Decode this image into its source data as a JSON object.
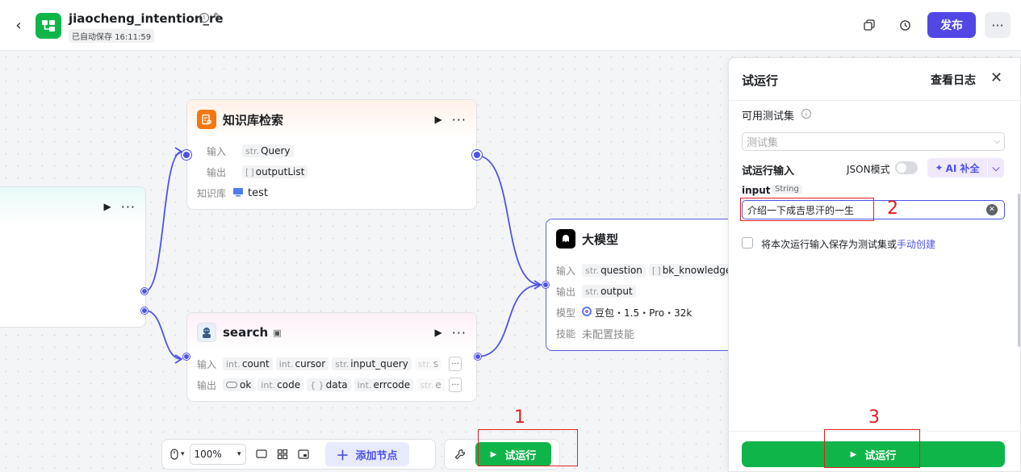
{
  "header": {
    "title": "jiaocheng_intention_re",
    "autosave": "已自动保存 16:11:59",
    "publish_label": "发布",
    "more_label": "···"
  },
  "nodes": {
    "left_partial": {
      "actions_more": "···"
    },
    "knowledge": {
      "title": "知识库检索",
      "input_label": "输入",
      "input_type": "str.",
      "input_value": "Query",
      "output_label": "输出",
      "output_type": "[ ]",
      "output_value": "outputList",
      "kb_label": "知识库",
      "kb_value": "test"
    },
    "search": {
      "title": "search",
      "input_label": "输入",
      "inputs": [
        {
          "type": "int.",
          "name": "count"
        },
        {
          "type": "int.",
          "name": "cursor"
        },
        {
          "type": "str.",
          "name": "input_query"
        },
        {
          "type": "str.",
          "name": "s"
        }
      ],
      "output_label": "输出",
      "outputs": [
        {
          "type": "",
          "name": "ok"
        },
        {
          "type": "int.",
          "name": "code"
        },
        {
          "type": "{ }",
          "name": "data"
        },
        {
          "type": "int.",
          "name": "errcode"
        },
        {
          "type": "str.",
          "name": "e"
        }
      ]
    },
    "llm": {
      "title": "大模型",
      "input_label": "输入",
      "inputs": [
        {
          "type": "str.",
          "name": "question"
        },
        {
          "type": "[ ]",
          "name": "bk_knowledge"
        }
      ],
      "output_label": "输出",
      "output_type": "str.",
      "output_value": "output",
      "model_label": "模型",
      "model_value": "豆包・1.5・Pro・32k",
      "skill_label": "技能",
      "skill_value": "未配置技能"
    }
  },
  "toolbar": {
    "zoom": "100%",
    "add_node": "添加节点",
    "test_run": "试运行"
  },
  "panel": {
    "title": "试运行",
    "view_log": "查看日志",
    "testset_label": "可用测试集",
    "testset_placeholder": "测试集",
    "run_input_label": "试运行输入",
    "json_mode": "JSON模式",
    "ai_fill": "AI 补全",
    "input_name": "input",
    "input_type": "String",
    "input_value": "介绍一下成吉思汗的一生",
    "save_text": "将本次运行输入保存为测试集或",
    "save_link": "手动创建",
    "run_button": "试运行"
  },
  "annotations": [
    "1",
    "2",
    "3"
  ],
  "colors": {
    "brand": "#5147e5",
    "accent": "#4d53e8",
    "run_green": "#10b54a",
    "annotation_red": "#e02020"
  }
}
